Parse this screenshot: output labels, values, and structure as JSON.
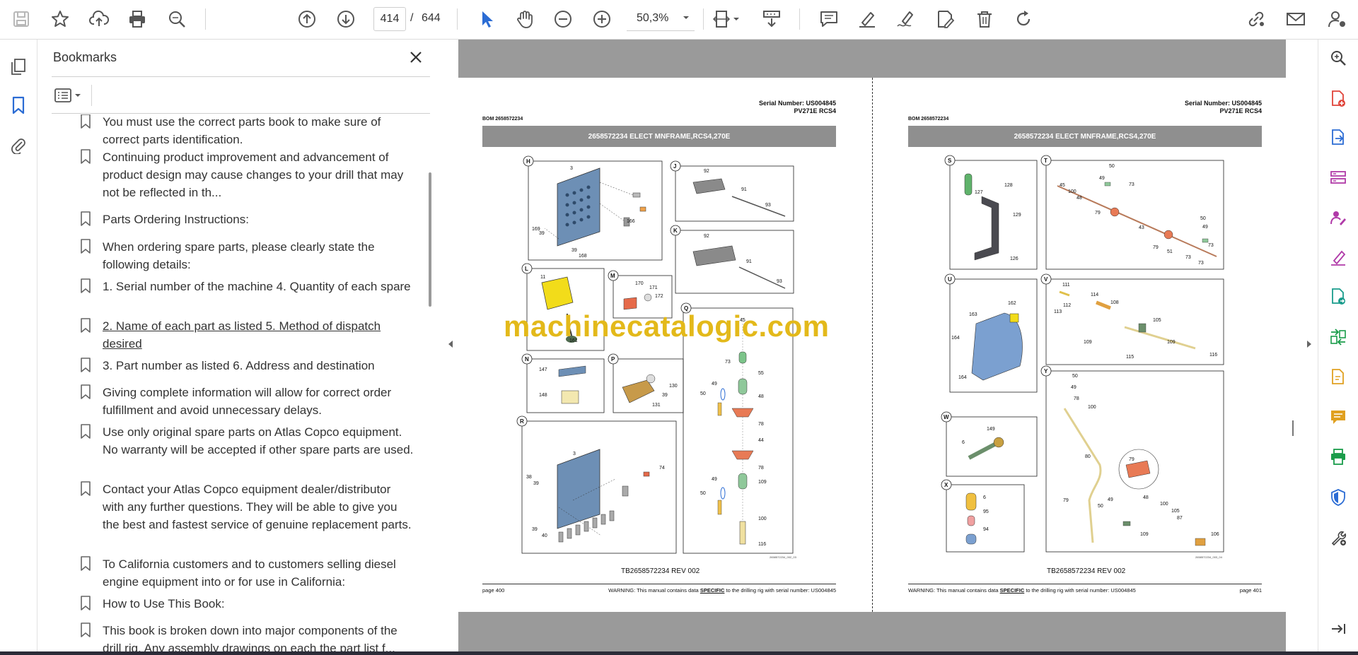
{
  "toolbar": {
    "page_current": "414",
    "page_separator": "/",
    "page_total": "644",
    "zoom": "50,3%"
  },
  "bookmarks": {
    "title": "Bookmarks",
    "items": [
      {
        "label": "You must use the correct parts book to make sure of correct parts identification."
      },
      {
        "label": "Continuing product improvement and advancement of product design may cause changes to your drill that may not be reflected in th..."
      },
      {
        "label": "Parts Ordering Instructions:"
      },
      {
        "label": "When ordering spare parts, please clearly state the following details:"
      },
      {
        "label": "1. Serial number of the machine 4. Quantity of each spare"
      },
      {
        "label": "2. Name of each part as listed 5. Method of dispatch desired"
      },
      {
        "label": "3. Part number as listed 6. Address and destination"
      },
      {
        "label": "Giving complete information will allow for correct order fulfillment and avoid unnecessary delays."
      },
      {
        "label": "Use only original spare parts on Atlas Copco equipment. No warranty will be accepted if other spare parts are used."
      },
      {
        "label": "Contact your Atlas Copco equipment dealer/distributor with any further questions. They will be able to give you the best and fastest service of genuine replacement parts."
      },
      {
        "label": "To California customers and to customers selling diesel engine equipment into or for use in California:"
      },
      {
        "label": "How to Use This Book:"
      },
      {
        "label": "This book is broken down into major components of the drill rig. Any assembly drawings on each the part list f..."
      }
    ]
  },
  "watermark": "machinecatalogic.com",
  "left_page": {
    "serial_line1": "Serial Number: US004845",
    "serial_line2": "PV271E RCS4",
    "bom": "BOM 2658572234",
    "title": "2658572234 ELECT MNFRAME,RCS4,270E",
    "drawing_ref": "TB2658572234 REV 002",
    "page_label": "page 400",
    "warning_pre": "WARNING:  This manual contains data ",
    "warning_specific": "SPECIFIC",
    "warning_post": " to the drilling rig with serial number: US004845",
    "image_code": "2658572234_002_03",
    "callouts": {
      "H": "H",
      "J": "J",
      "K": "K",
      "L": "L",
      "M": "M",
      "N": "N",
      "P": "P",
      "Q": "Q",
      "R": "R",
      "h3": "3",
      "h169": "169",
      "h39": "39",
      "h39b": "39",
      "h168": "168",
      "h166": "166",
      "j92": "92",
      "j91": "91",
      "j93": "93",
      "k92": "92",
      "k91": "91",
      "k93": "93",
      "l11": "11",
      "l161": "161",
      "m170": "170",
      "m171": "171",
      "m172": "172",
      "n147": "147",
      "n148": "148",
      "p130": "130",
      "p39": "39",
      "p131": "131",
      "q45": "45",
      "q73": "73",
      "q55": "55",
      "q49": "49",
      "q50": "50",
      "q48": "48",
      "q78": "78",
      "q44": "44",
      "q78b": "78",
      "q49b": "49",
      "q50b": "50",
      "q109": "109",
      "q100": "100",
      "q116": "116",
      "r3": "3",
      "r38": "38",
      "r39": "39",
      "r74": "74",
      "r39b": "39",
      "r40": "40"
    }
  },
  "right_page": {
    "serial_line1": "Serial Number: US004845",
    "serial_line2": "PV271E RCS4",
    "bom": "BOM 2658572234",
    "title": "2658572234 ELECT MNFRAME,RCS4,270E",
    "drawing_ref": "TB2658572234 REV 002",
    "page_label": "page 401",
    "warning_pre": "WARNING:  This manual contains data ",
    "warning_specific": "SPECIFIC",
    "warning_post": " to the drilling rig with serial number: US004845",
    "image_code": "2658572234_003_04",
    "callouts": {
      "S": "S",
      "T": "T",
      "U": "U",
      "V": "V",
      "W": "W",
      "X": "X",
      "Y": "Y",
      "s127": "127",
      "s128": "128",
      "s129": "129",
      "s126": "126",
      "t50": "50",
      "t45": "45",
      "t100": "100",
      "t48": "48",
      "t49": "49",
      "t73": "73",
      "t79": "79",
      "t43": "43",
      "t79b": "79",
      "t51": "51",
      "t73b": "73",
      "t73c": "73",
      "t50b": "50",
      "t49b": "49",
      "t73d": "73",
      "u162": "162",
      "u163": "163",
      "u164": "164",
      "u164b": "164",
      "v111": "111",
      "v114": "114",
      "v108": "108",
      "v112": "112",
      "v113": "113",
      "v109": "109",
      "v105": "105",
      "v115": "115",
      "v109b": "109",
      "v116": "116",
      "w149": "149",
      "w6": "6",
      "x6": "6",
      "x95": "95",
      "x94": "94",
      "y50": "50",
      "y49": "49",
      "y78": "78",
      "y100": "100",
      "y80": "80",
      "y79": "79",
      "y79b": "79",
      "y49b": "49",
      "y50b": "50",
      "y48": "48",
      "y100b": "100",
      "y105": "105",
      "y87": "87",
      "y109": "109",
      "y106": "106"
    }
  }
}
